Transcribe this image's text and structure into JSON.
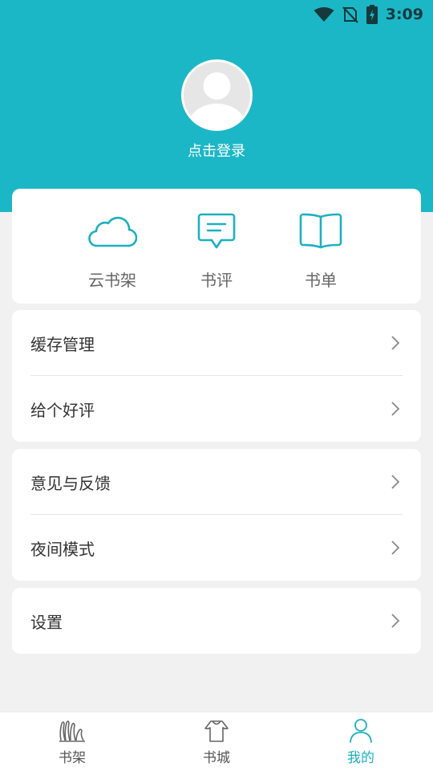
{
  "status_bar": {
    "time": "3:09",
    "icons": [
      "wifi-icon",
      "no-sim-icon",
      "battery-charging-icon"
    ]
  },
  "profile": {
    "avatar_icon": "default-avatar-icon",
    "login_label": "点击登录"
  },
  "quick_actions": [
    {
      "label": "云书架",
      "icon": "cloud-icon"
    },
    {
      "label": "书评",
      "icon": "comment-icon"
    },
    {
      "label": "书单",
      "icon": "open-book-icon"
    }
  ],
  "menu_groups": [
    {
      "items": [
        {
          "label": "缓存管理"
        },
        {
          "label": "给个好评"
        }
      ]
    },
    {
      "items": [
        {
          "label": "意见与反馈"
        },
        {
          "label": "夜间模式"
        }
      ]
    },
    {
      "items": [
        {
          "label": "设置"
        }
      ]
    }
  ],
  "tab_bar": {
    "tabs": [
      {
        "label": "书架",
        "icon": "bookshelf-icon",
        "active": false
      },
      {
        "label": "书城",
        "icon": "bookstore-icon",
        "active": false
      },
      {
        "label": "我的",
        "icon": "person-icon",
        "active": true
      }
    ]
  },
  "colors": {
    "primary": "#1cb7c7",
    "accent": "#1cb0bf",
    "background": "#f1f1f1",
    "card": "#ffffff"
  }
}
